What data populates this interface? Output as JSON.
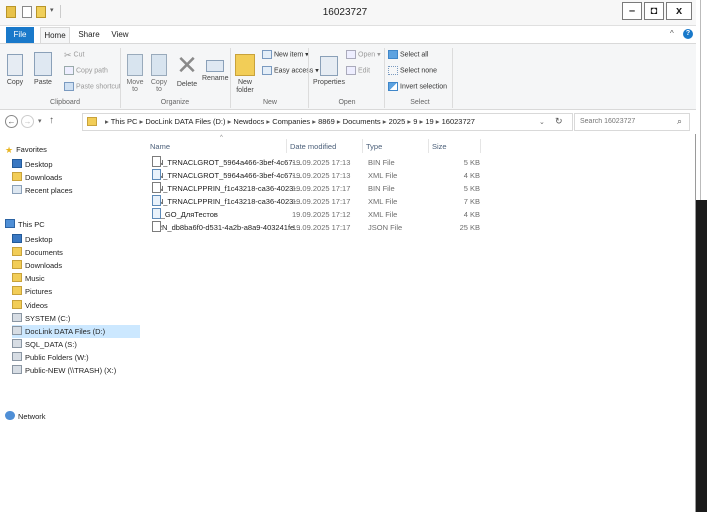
{
  "window": {
    "title": "16023727"
  },
  "tabs": {
    "file": "File",
    "home": "Home",
    "share": "Share",
    "view": "View"
  },
  "ribbon": {
    "clipboard": {
      "copy": "Copy",
      "paste": "Paste",
      "cut": "Cut",
      "copy_path": "Copy path",
      "paste_shortcut": "Paste shortcut",
      "label": "Clipboard"
    },
    "organize": {
      "move_to": "Move to",
      "copy_to": "Copy to",
      "delete": "Delete",
      "rename": "Rename",
      "label": "Organize"
    },
    "new": {
      "new_item": "New item",
      "easy_access": "Easy access",
      "new_folder": "New folder",
      "label": "New"
    },
    "open": {
      "properties": "Properties",
      "open": "Open",
      "edit": "Edit",
      "label": "Open"
    },
    "select": {
      "select_all": "Select all",
      "select_none": "Select none",
      "invert": "Invert selection",
      "label": "Select"
    }
  },
  "address": {
    "crumbs": [
      "This PC",
      "DocLink DATA Files (D:)",
      "Newdocs",
      "Companies",
      "8869",
      "Documents",
      "2025",
      "9",
      "19",
      "16023727"
    ],
    "search_placeholder": "Search 16023727"
  },
  "nav": {
    "favorites": "Favorites",
    "fav_items": [
      "Desktop",
      "Downloads",
      "Recent places"
    ],
    "this_pc": "This PC",
    "pc_items": [
      "Desktop",
      "Documents",
      "Downloads",
      "Music",
      "Pictures",
      "Videos",
      "SYSTEM (C:)",
      "DocLink DATA Files (D:)",
      "SQL_DATA (S:)",
      "Public Folders (W:)",
      "Public-NEW (\\\\TRASH) (X:)"
    ],
    "network": "Network"
  },
  "columns": {
    "name": "Name",
    "date": "Date modified",
    "type": "Type",
    "size": "Size"
  },
  "files": [
    {
      "name": "ON_TRNACLGROT_5964a466-3bef-4c67-...",
      "date": "19.09.2025 17:13",
      "type": "BIN File",
      "size": "5 KB",
      "icon": "file-icon"
    },
    {
      "name": "ON_TRNACLGROT_5964a466-3bef-4c67-...",
      "date": "19.09.2025 17:13",
      "type": "XML File",
      "size": "4 KB",
      "icon": "xml-file-icon"
    },
    {
      "name": "ON_TRNACLPPRIN_f1c43218-ca36-4023-...",
      "date": "19.09.2025 17:17",
      "type": "BIN File",
      "size": "5 KB",
      "icon": "file-icon"
    },
    {
      "name": "ON_TRNACLPPRIN_f1c43218-ca36-4023-...",
      "date": "19.09.2025 17:17",
      "type": "XML File",
      "size": "7 KB",
      "icon": "xml-file-icon"
    },
    {
      "name": "T1_GO_ДляТестов",
      "date": "19.09.2025 17:12",
      "type": "XML File",
      "size": "4 KB",
      "icon": "xml-file-icon"
    },
    {
      "name": "TRN_db8ba6f0-d531-4a2b-a8a9-403241fe...",
      "date": "19.09.2025 17:17",
      "type": "JSON File",
      "size": "25 KB",
      "icon": "file-icon"
    }
  ]
}
